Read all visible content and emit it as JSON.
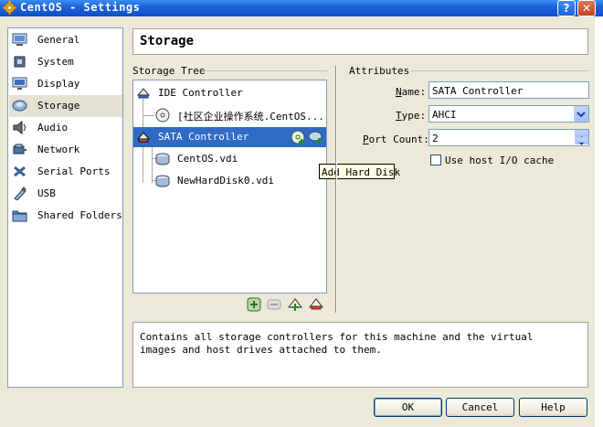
{
  "window": {
    "title": "CentOS - Settings",
    "help_glyph": "?",
    "close_glyph": "✕"
  },
  "sidebar": {
    "items": [
      {
        "label": "General",
        "icon": "general-icon"
      },
      {
        "label": "System",
        "icon": "system-icon"
      },
      {
        "label": "Display",
        "icon": "display-icon"
      },
      {
        "label": "Storage",
        "icon": "storage-icon",
        "selected": true
      },
      {
        "label": "Audio",
        "icon": "audio-icon"
      },
      {
        "label": "Network",
        "icon": "network-icon"
      },
      {
        "label": "Serial Ports",
        "icon": "serial-ports-icon"
      },
      {
        "label": "USB",
        "icon": "usb-icon"
      },
      {
        "label": "Shared Folders",
        "icon": "shared-folders-icon"
      }
    ]
  },
  "page": {
    "title": "Storage"
  },
  "storage_tree": {
    "label": "Storage Tree",
    "items": [
      {
        "label": "IDE Controller"
      },
      {
        "label": "[社区企业操作系统.CentOS..."
      },
      {
        "label": "SATA Controller",
        "selected": true
      },
      {
        "label": "CentOS.vdi"
      },
      {
        "label": "NewHardDisk0.vdi"
      }
    ],
    "tooltip": "Add Hard Disk"
  },
  "attributes": {
    "label": "Attributes",
    "name": {
      "label_key": "N",
      "label_rest": "ame:",
      "value": "SATA Controller"
    },
    "type": {
      "label_key": "T",
      "label_rest": "ype:",
      "value": "AHCI"
    },
    "port_count": {
      "label_key": "P",
      "label_rest": "ort Count:",
      "value": "2"
    },
    "host_cache": {
      "label": "Use host I/O cache",
      "checked": false
    }
  },
  "description": "Contains all storage controllers for this machine and the virtual images and host drives attached to them.",
  "buttons": {
    "ok": "OK",
    "cancel": "Cancel",
    "help": "Help"
  },
  "colors": {
    "titlebar": "#0d4fc8",
    "selection": "#316ac5",
    "tooltip_bg": "#ffffe1",
    "dialog_bg": "#ece9d8"
  }
}
